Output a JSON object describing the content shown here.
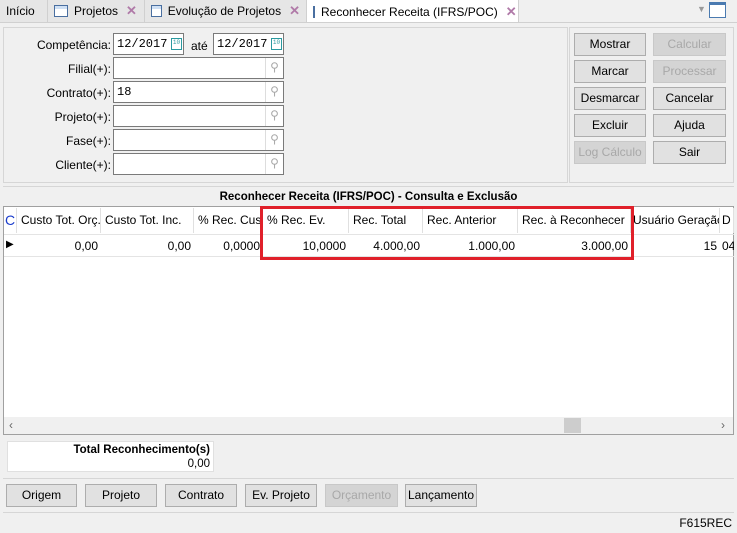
{
  "tabs": [
    {
      "label": "Início"
    },
    {
      "label": "Projetos"
    },
    {
      "label": "Evolução de Projetos"
    },
    {
      "label": "Reconhecer Receita (IFRS/POC)",
      "active": true
    }
  ],
  "filters": {
    "competencia_label": "Competência:",
    "competencia_from": "12/2017",
    "ate_label": "até",
    "competencia_to": "12/2017",
    "filial_label": "Filial(+):",
    "filial_value": "",
    "contrato_label": "Contrato(+):",
    "contrato_value": "18",
    "projeto_label": "Projeto(+):",
    "projeto_value": "",
    "fase_label": "Fase(+):",
    "fase_value": "",
    "cliente_label": "Cliente(+):",
    "cliente_value": ""
  },
  "actions": {
    "mostrar": "Mostrar",
    "calcular": "Calcular",
    "marcar": "Marcar",
    "processar": "Processar",
    "desmarcar": "Desmarcar",
    "cancelar": "Cancelar",
    "excluir": "Excluir",
    "ajuda": "Ajuda",
    "log_calculo": "Log Cálculo",
    "sair": "Sair"
  },
  "grid": {
    "title": "Reconhecer Receita (IFRS/POC) - Consulta e Exclusão",
    "columns": [
      "C",
      "Custo Tot. Orç.",
      "Custo Tot. Inc.",
      "% Rec. Custo",
      "% Rec. Ev.",
      "Rec. Total",
      "Rec. Anterior",
      "Rec. à Reconhecer",
      "Usuário Geração",
      "D"
    ],
    "rows": [
      [
        "",
        "0,00",
        "0,00",
        "0,0000",
        "10,0000",
        "4.000,00",
        "1.000,00",
        "3.000,00",
        "15",
        "04"
      ]
    ]
  },
  "highlight_color": "#e0202a",
  "total": {
    "label": "Total Reconhecimento(s)",
    "value": "0,00"
  },
  "bottom_buttons": {
    "origem": "Origem",
    "projeto": "Projeto",
    "contrato": "Contrato",
    "ev_projeto": "Ev. Projeto",
    "orcamento": "Orçamento",
    "lancamento": "Lançamento"
  },
  "status": {
    "code": "F615REC"
  }
}
